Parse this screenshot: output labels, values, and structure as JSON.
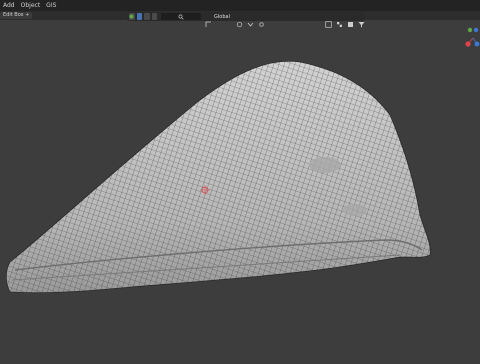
{
  "menu": {
    "items": [
      "Add",
      "Object",
      "GIS"
    ]
  },
  "header": {
    "mode_label": "Edit Box +"
  },
  "toolbar": {
    "orientation_label": "Global"
  },
  "colors": {
    "background": "#3d3d3d",
    "mesh_fill": "#bfbfbf",
    "mesh_wire": "#2a2a2a",
    "accent_blue": "#4772b3",
    "gizmo_red": "#e0424a",
    "gizmo_green": "#5fa84a",
    "gizmo_blue": "#3d7ad6"
  },
  "icons": [
    "mode-select-icon",
    "global-orientation-icon",
    "pivot-icon",
    "snap-icon",
    "proportional-edit-icon",
    "overlay-icon",
    "filter-icon",
    "3d-cursor-icon",
    "navigation-gizmo-icon"
  ]
}
